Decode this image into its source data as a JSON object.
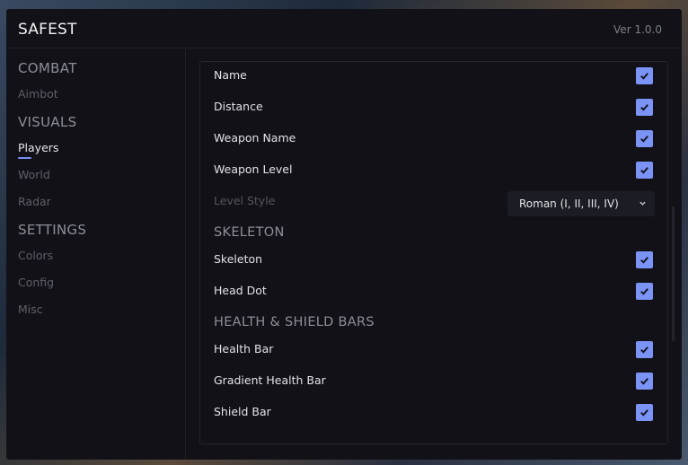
{
  "app": {
    "title": "SAFEST",
    "version": "Ver 1.0.0"
  },
  "sidebar": {
    "sections": [
      {
        "title": "COMBAT",
        "items": [
          {
            "label": "Aimbot",
            "active": false
          }
        ]
      },
      {
        "title": "VISUALS",
        "items": [
          {
            "label": "Players",
            "active": true
          },
          {
            "label": "World",
            "active": false
          },
          {
            "label": "Radar",
            "active": false
          }
        ]
      },
      {
        "title": "SETTINGS",
        "items": [
          {
            "label": "Colors",
            "active": false
          },
          {
            "label": "Config",
            "active": false
          },
          {
            "label": "Misc",
            "active": false
          }
        ]
      }
    ]
  },
  "panel": {
    "general": {
      "name": {
        "label": "Name",
        "checked": true
      },
      "distance": {
        "label": "Distance",
        "checked": true
      },
      "weapon_name": {
        "label": "Weapon Name",
        "checked": true
      },
      "weapon_level": {
        "label": "Weapon Level",
        "checked": true
      },
      "level_style": {
        "label": "Level Style",
        "value": "Roman (I, II, III, IV)"
      }
    },
    "skeleton": {
      "title": "SKELETON",
      "skeleton": {
        "label": "Skeleton",
        "checked": true
      },
      "head_dot": {
        "label": "Head Dot",
        "checked": true
      }
    },
    "bars": {
      "title": "HEALTH & SHIELD BARS",
      "health_bar": {
        "label": "Health Bar",
        "checked": true
      },
      "gradient_health_bar": {
        "label": "Gradient Health Bar",
        "checked": true
      },
      "shield_bar": {
        "label": "Shield Bar",
        "checked": true
      }
    }
  },
  "colors": {
    "accent": "#7a93f5",
    "background": "#111117",
    "text": "#e2e2e8",
    "muted": "#5f5f6a"
  },
  "icons": {
    "checkbox": "check-icon",
    "dropdown": "chevron-down-icon"
  }
}
